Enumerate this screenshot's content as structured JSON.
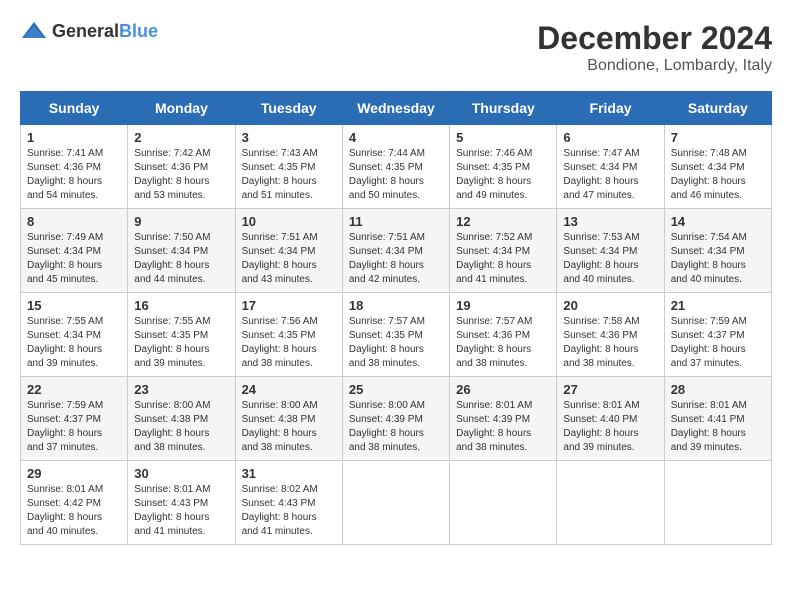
{
  "logo": {
    "text_general": "General",
    "text_blue": "Blue"
  },
  "title": "December 2024",
  "location": "Bondione, Lombardy, Italy",
  "weekdays": [
    "Sunday",
    "Monday",
    "Tuesday",
    "Wednesday",
    "Thursday",
    "Friday",
    "Saturday"
  ],
  "weeks": [
    [
      {
        "day": "1",
        "sunrise": "7:41 AM",
        "sunset": "4:36 PM",
        "daylight": "8 hours and 54 minutes."
      },
      {
        "day": "2",
        "sunrise": "7:42 AM",
        "sunset": "4:36 PM",
        "daylight": "8 hours and 53 minutes."
      },
      {
        "day": "3",
        "sunrise": "7:43 AM",
        "sunset": "4:35 PM",
        "daylight": "8 hours and 51 minutes."
      },
      {
        "day": "4",
        "sunrise": "7:44 AM",
        "sunset": "4:35 PM",
        "daylight": "8 hours and 50 minutes."
      },
      {
        "day": "5",
        "sunrise": "7:46 AM",
        "sunset": "4:35 PM",
        "daylight": "8 hours and 49 minutes."
      },
      {
        "day": "6",
        "sunrise": "7:47 AM",
        "sunset": "4:34 PM",
        "daylight": "8 hours and 47 minutes."
      },
      {
        "day": "7",
        "sunrise": "7:48 AM",
        "sunset": "4:34 PM",
        "daylight": "8 hours and 46 minutes."
      }
    ],
    [
      {
        "day": "8",
        "sunrise": "7:49 AM",
        "sunset": "4:34 PM",
        "daylight": "8 hours and 45 minutes."
      },
      {
        "day": "9",
        "sunrise": "7:50 AM",
        "sunset": "4:34 PM",
        "daylight": "8 hours and 44 minutes."
      },
      {
        "day": "10",
        "sunrise": "7:51 AM",
        "sunset": "4:34 PM",
        "daylight": "8 hours and 43 minutes."
      },
      {
        "day": "11",
        "sunrise": "7:51 AM",
        "sunset": "4:34 PM",
        "daylight": "8 hours and 42 minutes."
      },
      {
        "day": "12",
        "sunrise": "7:52 AM",
        "sunset": "4:34 PM",
        "daylight": "8 hours and 41 minutes."
      },
      {
        "day": "13",
        "sunrise": "7:53 AM",
        "sunset": "4:34 PM",
        "daylight": "8 hours and 40 minutes."
      },
      {
        "day": "14",
        "sunrise": "7:54 AM",
        "sunset": "4:34 PM",
        "daylight": "8 hours and 40 minutes."
      }
    ],
    [
      {
        "day": "15",
        "sunrise": "7:55 AM",
        "sunset": "4:34 PM",
        "daylight": "8 hours and 39 minutes."
      },
      {
        "day": "16",
        "sunrise": "7:55 AM",
        "sunset": "4:35 PM",
        "daylight": "8 hours and 39 minutes."
      },
      {
        "day": "17",
        "sunrise": "7:56 AM",
        "sunset": "4:35 PM",
        "daylight": "8 hours and 38 minutes."
      },
      {
        "day": "18",
        "sunrise": "7:57 AM",
        "sunset": "4:35 PM",
        "daylight": "8 hours and 38 minutes."
      },
      {
        "day": "19",
        "sunrise": "7:57 AM",
        "sunset": "4:36 PM",
        "daylight": "8 hours and 38 minutes."
      },
      {
        "day": "20",
        "sunrise": "7:58 AM",
        "sunset": "4:36 PM",
        "daylight": "8 hours and 38 minutes."
      },
      {
        "day": "21",
        "sunrise": "7:59 AM",
        "sunset": "4:37 PM",
        "daylight": "8 hours and 37 minutes."
      }
    ],
    [
      {
        "day": "22",
        "sunrise": "7:59 AM",
        "sunset": "4:37 PM",
        "daylight": "8 hours and 37 minutes."
      },
      {
        "day": "23",
        "sunrise": "8:00 AM",
        "sunset": "4:38 PM",
        "daylight": "8 hours and 38 minutes."
      },
      {
        "day": "24",
        "sunrise": "8:00 AM",
        "sunset": "4:38 PM",
        "daylight": "8 hours and 38 minutes."
      },
      {
        "day": "25",
        "sunrise": "8:00 AM",
        "sunset": "4:39 PM",
        "daylight": "8 hours and 38 minutes."
      },
      {
        "day": "26",
        "sunrise": "8:01 AM",
        "sunset": "4:39 PM",
        "daylight": "8 hours and 38 minutes."
      },
      {
        "day": "27",
        "sunrise": "8:01 AM",
        "sunset": "4:40 PM",
        "daylight": "8 hours and 39 minutes."
      },
      {
        "day": "28",
        "sunrise": "8:01 AM",
        "sunset": "4:41 PM",
        "daylight": "8 hours and 39 minutes."
      }
    ],
    [
      {
        "day": "29",
        "sunrise": "8:01 AM",
        "sunset": "4:42 PM",
        "daylight": "8 hours and 40 minutes."
      },
      {
        "day": "30",
        "sunrise": "8:01 AM",
        "sunset": "4:43 PM",
        "daylight": "8 hours and 41 minutes."
      },
      {
        "day": "31",
        "sunrise": "8:02 AM",
        "sunset": "4:43 PM",
        "daylight": "8 hours and 41 minutes."
      },
      null,
      null,
      null,
      null
    ]
  ]
}
